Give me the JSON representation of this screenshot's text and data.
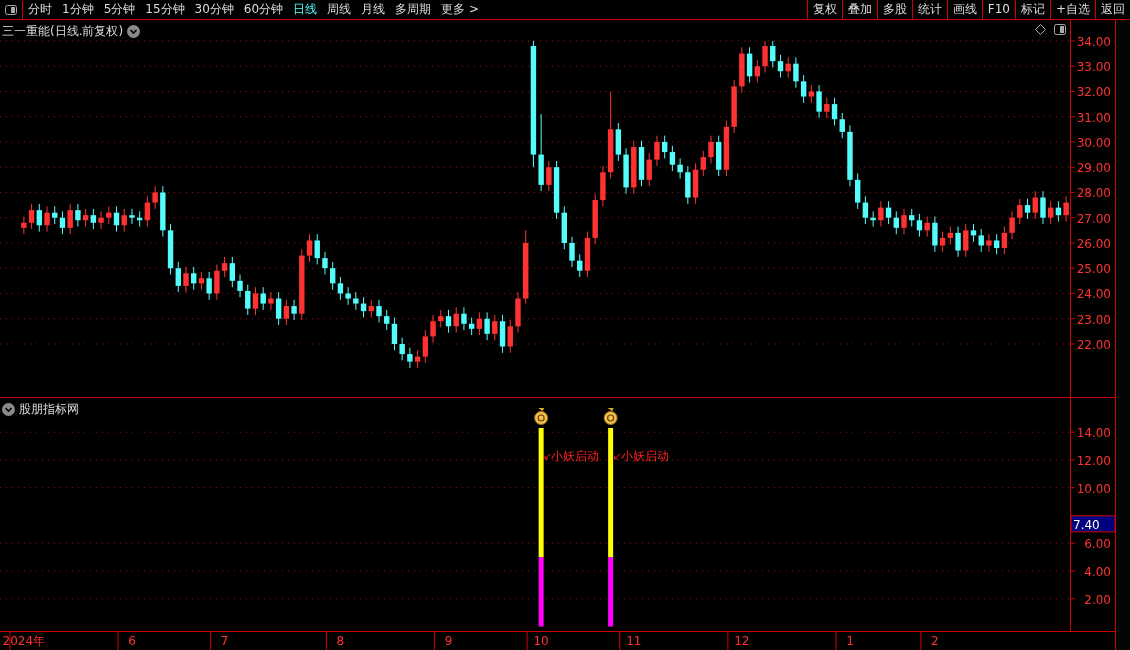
{
  "toolbar": {
    "periods": [
      {
        "label": "分时",
        "selected": false
      },
      {
        "label": "1分钟",
        "selected": false
      },
      {
        "label": "5分钟",
        "selected": false
      },
      {
        "label": "15分钟",
        "selected": false
      },
      {
        "label": "30分钟",
        "selected": false
      },
      {
        "label": "60分钟",
        "selected": false
      },
      {
        "label": "日线",
        "selected": true
      },
      {
        "label": "周线",
        "selected": false
      },
      {
        "label": "月线",
        "selected": false
      },
      {
        "label": "多周期",
        "selected": false
      },
      {
        "label": "更多 >",
        "selected": false
      }
    ],
    "actions": [
      "复权",
      "叠加",
      "多股",
      "统计",
      "画线",
      "F10",
      "标记",
      "+自选",
      "返回"
    ]
  },
  "price_chart": {
    "title": "三一重能(日线.前复权)",
    "chart_data": {
      "type": "candlestick",
      "grid": true,
      "ylim": [
        19.9,
        34.83
      ],
      "yticks": [
        {
          "value": 22,
          "label": "22.00"
        },
        {
          "value": 23,
          "label": "23.00"
        },
        {
          "value": 24,
          "label": "24.00"
        },
        {
          "value": 25,
          "label": "25.00"
        },
        {
          "value": 26,
          "label": "26.00"
        },
        {
          "value": 27,
          "label": "27.00"
        },
        {
          "value": 28,
          "label": "28.00"
        },
        {
          "value": 29,
          "label": "29.00"
        },
        {
          "value": 30,
          "label": "30.00"
        },
        {
          "value": 31,
          "label": "31.00"
        },
        {
          "value": 32,
          "label": "32.00"
        },
        {
          "value": 33,
          "label": "33.00"
        },
        {
          "value": 34,
          "label": "34.00"
        }
      ],
      "categories": [
        null,
        null,
        null,
        null,
        null,
        null,
        null,
        null,
        null,
        null,
        null,
        null,
        null,
        null,
        null,
        null,
        null,
        null,
        null,
        null,
        null,
        null,
        null,
        null,
        null,
        null,
        null,
        null,
        null,
        null,
        null,
        null,
        null,
        null,
        null,
        null,
        null,
        null,
        null,
        null,
        null,
        null,
        null,
        null,
        null,
        null,
        null,
        null,
        null,
        null,
        null,
        null,
        null,
        null,
        null,
        null,
        null,
        null,
        null,
        null,
        null,
        null,
        null,
        null,
        null,
        null,
        null,
        null,
        null,
        null,
        null,
        null,
        null,
        null,
        null,
        null,
        null,
        null,
        null,
        null,
        null,
        null,
        null,
        null,
        null,
        null,
        null,
        null,
        null,
        null,
        null,
        null,
        null,
        null,
        null,
        null,
        null,
        null,
        null,
        null,
        null,
        null,
        null,
        null,
        null,
        null,
        null,
        null,
        null,
        null,
        null,
        null,
        null,
        null,
        null,
        null,
        null,
        null,
        null,
        null,
        null,
        null,
        null,
        null,
        null,
        null,
        null,
        null,
        null,
        null,
        null,
        null,
        null,
        null,
        null,
        null
      ],
      "ohlc": [
        [
          26.6,
          27.05,
          26.35,
          26.8
        ],
        [
          26.8,
          27.55,
          26.55,
          27.3
        ],
        [
          27.3,
          27.55,
          26.45,
          26.7
        ],
        [
          26.7,
          27.45,
          26.45,
          27.2
        ],
        [
          27.2,
          27.45,
          26.75,
          27.0
        ],
        [
          27.0,
          27.25,
          26.35,
          26.6
        ],
        [
          26.6,
          27.55,
          26.35,
          27.3
        ],
        [
          27.3,
          27.55,
          26.65,
          26.9
        ],
        [
          26.9,
          27.35,
          26.65,
          27.1
        ],
        [
          27.1,
          27.35,
          26.55,
          26.8
        ],
        [
          26.8,
          27.25,
          26.55,
          27.0
        ],
        [
          27.0,
          27.45,
          26.75,
          27.2
        ],
        [
          27.2,
          27.45,
          26.45,
          26.7
        ],
        [
          26.7,
          27.35,
          26.45,
          27.1
        ],
        [
          27.1,
          27.35,
          26.75,
          27.0
        ],
        [
          27.0,
          27.25,
          26.65,
          26.9
        ],
        [
          26.9,
          27.85,
          26.65,
          27.6
        ],
        [
          27.6,
          28.25,
          27.35,
          28.0
        ],
        [
          28.0,
          28.25,
          26.25,
          26.5
        ],
        [
          26.5,
          26.75,
          24.75,
          25.0
        ],
        [
          25.0,
          25.25,
          24.05,
          24.3
        ],
        [
          24.3,
          25.05,
          24.05,
          24.8
        ],
        [
          24.8,
          25.05,
          24.15,
          24.4
        ],
        [
          24.4,
          24.85,
          24.15,
          24.6
        ],
        [
          24.6,
          24.85,
          23.75,
          24.0
        ],
        [
          24.0,
          25.15,
          23.75,
          24.9
        ],
        [
          24.9,
          25.45,
          24.65,
          25.2
        ],
        [
          25.2,
          25.45,
          24.25,
          24.5
        ],
        [
          24.5,
          24.75,
          23.85,
          24.1
        ],
        [
          24.1,
          24.35,
          23.15,
          23.4
        ],
        [
          23.4,
          24.25,
          23.15,
          24.0
        ],
        [
          24.0,
          24.25,
          23.35,
          23.6
        ],
        [
          23.6,
          24.05,
          23.35,
          23.8
        ],
        [
          23.8,
          24.05,
          22.75,
          23.0
        ],
        [
          23.0,
          23.75,
          22.75,
          23.5
        ],
        [
          23.5,
          23.75,
          22.95,
          23.2
        ],
        [
          23.2,
          25.75,
          22.95,
          25.5
        ],
        [
          25.5,
          26.35,
          25.25,
          26.1
        ],
        [
          26.1,
          26.35,
          25.15,
          25.4
        ],
        [
          25.4,
          25.65,
          24.75,
          25.0
        ],
        [
          25.0,
          25.25,
          24.15,
          24.4
        ],
        [
          24.4,
          24.65,
          23.75,
          24.0
        ],
        [
          24.0,
          24.25,
          23.55,
          23.8
        ],
        [
          23.8,
          24.05,
          23.35,
          23.6
        ],
        [
          23.6,
          23.85,
          23.05,
          23.3
        ],
        [
          23.3,
          23.75,
          23.05,
          23.5
        ],
        [
          23.5,
          23.75,
          22.85,
          23.1
        ],
        [
          23.1,
          23.35,
          22.55,
          22.8
        ],
        [
          22.8,
          23.05,
          21.75,
          22.0
        ],
        [
          22.0,
          22.25,
          21.35,
          21.6
        ],
        [
          21.6,
          21.85,
          21.05,
          21.3
        ],
        [
          21.3,
          21.75,
          21.05,
          21.5
        ],
        [
          21.5,
          22.55,
          21.25,
          22.3
        ],
        [
          22.3,
          23.15,
          22.05,
          22.9
        ],
        [
          22.9,
          23.35,
          22.65,
          23.1
        ],
        [
          23.1,
          23.35,
          22.45,
          22.7
        ],
        [
          22.7,
          23.45,
          22.45,
          23.2
        ],
        [
          23.2,
          23.45,
          22.55,
          22.8
        ],
        [
          22.8,
          23.05,
          22.35,
          22.6
        ],
        [
          22.6,
          23.25,
          22.35,
          23.0
        ],
        [
          23.0,
          23.25,
          22.15,
          22.4
        ],
        [
          22.4,
          23.15,
          22.15,
          22.9
        ],
        [
          22.9,
          23.15,
          21.65,
          21.9
        ],
        [
          21.9,
          22.95,
          21.65,
          22.7
        ],
        [
          22.7,
          24.05,
          22.45,
          23.8
        ],
        [
          23.8,
          26.5,
          23.6,
          26.0
        ],
        [
          33.8,
          34.0,
          29.0,
          29.5
        ],
        [
          29.5,
          31.1,
          28.05,
          28.3
        ],
        [
          28.3,
          29.25,
          28.05,
          29.0
        ],
        [
          29.0,
          29.25,
          26.95,
          27.2
        ],
        [
          27.2,
          27.45,
          25.75,
          26.0
        ],
        [
          26.0,
          26.25,
          25.05,
          25.3
        ],
        [
          25.3,
          25.55,
          24.65,
          24.9
        ],
        [
          24.9,
          26.45,
          24.65,
          26.2
        ],
        [
          26.2,
          27.95,
          25.95,
          27.7
        ],
        [
          27.7,
          29.05,
          27.45,
          28.8
        ],
        [
          28.8,
          32.0,
          28.55,
          30.5
        ],
        [
          30.5,
          30.75,
          29.25,
          29.5
        ],
        [
          29.5,
          29.75,
          27.95,
          28.2
        ],
        [
          28.2,
          30.05,
          27.95,
          29.8
        ],
        [
          29.8,
          30.05,
          28.25,
          28.5
        ],
        [
          28.5,
          29.55,
          28.25,
          29.3
        ],
        [
          29.3,
          30.25,
          29.05,
          30.0
        ],
        [
          30.0,
          30.25,
          29.35,
          29.6
        ],
        [
          29.6,
          29.85,
          28.85,
          29.1
        ],
        [
          29.1,
          29.35,
          28.55,
          28.8
        ],
        [
          28.8,
          29.05,
          27.55,
          27.8
        ],
        [
          27.8,
          29.15,
          27.55,
          28.9
        ],
        [
          28.9,
          29.65,
          28.65,
          29.4
        ],
        [
          29.4,
          30.25,
          29.15,
          30.0
        ],
        [
          30.0,
          30.25,
          28.65,
          28.9
        ],
        [
          28.9,
          30.85,
          28.65,
          30.6
        ],
        [
          30.6,
          32.45,
          30.35,
          32.2
        ],
        [
          32.2,
          33.75,
          31.95,
          33.5
        ],
        [
          33.5,
          33.75,
          32.35,
          32.6
        ],
        [
          32.6,
          33.25,
          32.35,
          33.0
        ],
        [
          33.0,
          34.0,
          32.75,
          33.8
        ],
        [
          33.8,
          34.0,
          32.95,
          33.2
        ],
        [
          33.2,
          33.45,
          32.55,
          32.8
        ],
        [
          32.8,
          33.35,
          32.55,
          33.1
        ],
        [
          33.1,
          33.35,
          32.15,
          32.4
        ],
        [
          32.4,
          32.65,
          31.55,
          31.8
        ],
        [
          31.8,
          32.25,
          31.55,
          32.0
        ],
        [
          32.0,
          32.25,
          30.95,
          31.2
        ],
        [
          31.2,
          31.75,
          30.95,
          31.5
        ],
        [
          31.5,
          31.75,
          30.65,
          30.9
        ],
        [
          30.9,
          31.15,
          30.15,
          30.4
        ],
        [
          30.4,
          30.65,
          28.25,
          28.5
        ],
        [
          28.5,
          28.75,
          27.35,
          27.6
        ],
        [
          27.6,
          27.85,
          26.75,
          27.0
        ],
        [
          27.0,
          27.25,
          26.65,
          26.9
        ],
        [
          26.9,
          27.65,
          26.65,
          27.4
        ],
        [
          27.4,
          27.65,
          26.75,
          27.0
        ],
        [
          27.0,
          27.25,
          26.35,
          26.6
        ],
        [
          26.6,
          27.35,
          26.35,
          27.1
        ],
        [
          27.1,
          27.35,
          26.65,
          26.9
        ],
        [
          26.9,
          27.15,
          26.25,
          26.5
        ],
        [
          26.5,
          27.05,
          26.25,
          26.8
        ],
        [
          26.8,
          27.05,
          25.65,
          25.9
        ],
        [
          25.9,
          26.45,
          25.65,
          26.2
        ],
        [
          26.2,
          26.65,
          25.95,
          26.4
        ],
        [
          26.4,
          26.65,
          25.45,
          25.7
        ],
        [
          25.7,
          26.75,
          25.45,
          26.5
        ],
        [
          26.5,
          26.75,
          26.05,
          26.3
        ],
        [
          26.3,
          26.55,
          25.65,
          25.9
        ],
        [
          25.9,
          26.35,
          25.65,
          26.1
        ],
        [
          26.1,
          26.35,
          25.55,
          25.8
        ],
        [
          25.8,
          26.65,
          25.55,
          26.4
        ],
        [
          26.4,
          27.25,
          26.15,
          27.0
        ],
        [
          27.0,
          27.75,
          26.75,
          27.5
        ],
        [
          27.5,
          27.75,
          26.95,
          27.2
        ],
        [
          27.2,
          28.05,
          26.95,
          27.8
        ],
        [
          27.8,
          28.05,
          26.75,
          27.0
        ],
        [
          27.0,
          27.65,
          26.75,
          27.4
        ],
        [
          27.4,
          27.65,
          26.85,
          27.1
        ],
        [
          27.1,
          27.85,
          26.85,
          27.6
        ]
      ]
    }
  },
  "indicator": {
    "title": "股朋指标网",
    "readout": "7.40",
    "signals": [
      {
        "label": "小妖启动"
      },
      {
        "label": "小妖启动"
      }
    ],
    "chart_data": {
      "type": "bar",
      "stacked": true,
      "grid": true,
      "ylim": [
        -0.32,
        16.46
      ],
      "yticks": [
        {
          "value": 2,
          "label": "2.00"
        },
        {
          "value": 4,
          "label": "4.00"
        },
        {
          "value": 6,
          "label": "6.00"
        },
        {
          "value": 10,
          "label": "10.00"
        },
        {
          "value": 12,
          "label": "12.00"
        },
        {
          "value": 14,
          "label": "14.00"
        }
      ],
      "categories": [
        "2024年",
        null,
        null,
        null,
        null,
        null,
        null,
        null,
        null,
        null,
        null,
        null,
        null,
        null,
        "6",
        null,
        null,
        null,
        null,
        null,
        null,
        null,
        null,
        null,
        null,
        null,
        "7",
        null,
        null,
        null,
        null,
        null,
        null,
        null,
        null,
        null,
        null,
        null,
        null,
        null,
        null,
        "8",
        null,
        null,
        null,
        null,
        null,
        null,
        null,
        null,
        null,
        null,
        null,
        null,
        null,
        "9",
        null,
        null,
        null,
        null,
        null,
        null,
        null,
        null,
        null,
        null,
        null,
        "10",
        null,
        null,
        null,
        null,
        null,
        null,
        null,
        null,
        null,
        null,
        null,
        "11",
        null,
        null,
        null,
        null,
        null,
        null,
        null,
        null,
        null,
        null,
        null,
        null,
        null,
        "12",
        null,
        null,
        null,
        null,
        null,
        null,
        null,
        null,
        null,
        null,
        null,
        null,
        null,
        "1",
        null,
        null,
        null,
        null,
        null,
        null,
        null,
        null,
        null,
        null,
        "2",
        null,
        null,
        null,
        null,
        null,
        null,
        null,
        null,
        null,
        null,
        null,
        null,
        null,
        null,
        null,
        null,
        null
      ],
      "series": [
        {
          "color": "#ff00ff",
          "values": [
            null,
            null,
            null,
            null,
            null,
            null,
            null,
            null,
            null,
            null,
            null,
            null,
            null,
            null,
            null,
            null,
            null,
            null,
            null,
            null,
            null,
            null,
            null,
            null,
            null,
            null,
            null,
            null,
            null,
            null,
            null,
            null,
            null,
            null,
            null,
            null,
            null,
            null,
            null,
            null,
            null,
            null,
            null,
            null,
            null,
            null,
            null,
            null,
            null,
            null,
            null,
            null,
            null,
            null,
            null,
            null,
            null,
            null,
            null,
            null,
            null,
            null,
            null,
            null,
            null,
            null,
            null,
            5,
            null,
            null,
            null,
            null,
            null,
            null,
            null,
            null,
            5,
            null,
            null,
            null,
            null,
            null,
            null,
            null,
            null,
            null,
            null,
            null,
            null,
            null,
            null,
            null,
            null,
            null,
            null,
            null,
            null,
            null,
            null,
            null,
            null,
            null,
            null,
            null,
            null,
            null,
            null,
            null,
            null,
            null,
            null,
            null,
            null,
            null,
            null,
            null,
            null,
            null,
            null,
            null,
            null,
            null,
            null,
            null,
            null,
            null,
            null,
            null,
            null,
            null,
            null,
            null,
            null,
            null,
            null,
            null
          ]
        },
        {
          "color": "#ffff00",
          "values": [
            null,
            null,
            null,
            null,
            null,
            null,
            null,
            null,
            null,
            null,
            null,
            null,
            null,
            null,
            null,
            null,
            null,
            null,
            null,
            null,
            null,
            null,
            null,
            null,
            null,
            null,
            null,
            null,
            null,
            null,
            null,
            null,
            null,
            null,
            null,
            null,
            null,
            null,
            null,
            null,
            null,
            null,
            null,
            null,
            null,
            null,
            null,
            null,
            null,
            null,
            null,
            null,
            null,
            null,
            null,
            null,
            null,
            null,
            null,
            null,
            null,
            null,
            null,
            null,
            null,
            null,
            null,
            9.3,
            null,
            null,
            null,
            null,
            null,
            null,
            null,
            null,
            9.3,
            null,
            null,
            null,
            null,
            null,
            null,
            null,
            null,
            null,
            null,
            null,
            null,
            null,
            null,
            null,
            null,
            null,
            null,
            null,
            null,
            null,
            null,
            null,
            null,
            null,
            null,
            null,
            null,
            null,
            null,
            null,
            null,
            null,
            null,
            null,
            null,
            null,
            null,
            null,
            null,
            null,
            null,
            null,
            null,
            null,
            null,
            null,
            null,
            null,
            null,
            null,
            null,
            null,
            null,
            null,
            null,
            null,
            null,
            null
          ]
        }
      ]
    }
  }
}
